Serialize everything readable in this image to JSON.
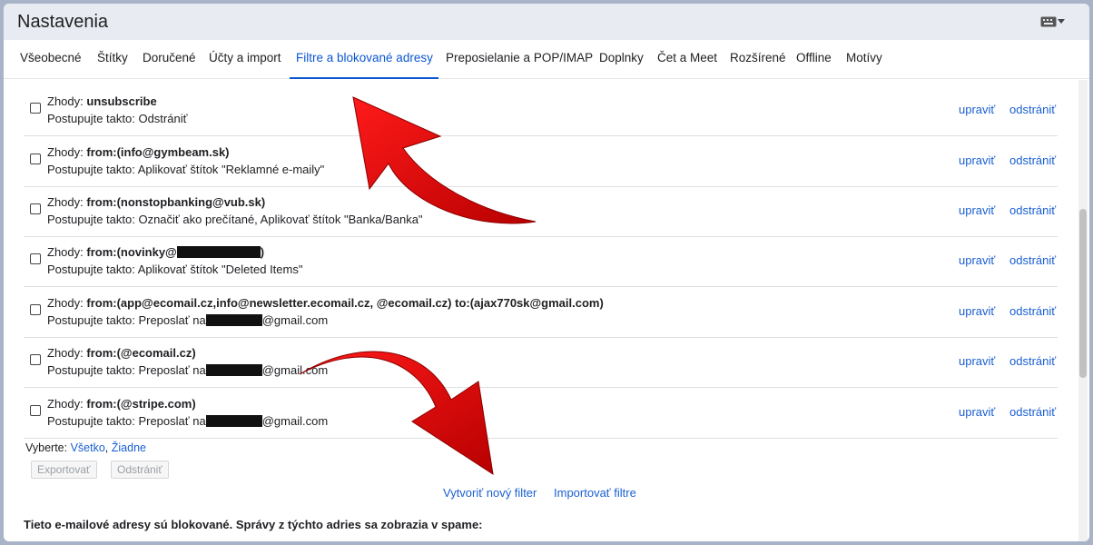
{
  "window": {
    "title": "Nastavenia",
    "input_icon": "keyboard-icon"
  },
  "tabs": [
    {
      "label": "Všeobecné"
    },
    {
      "label": "Štítky"
    },
    {
      "label": "Doručené"
    },
    {
      "label": "Účty a import"
    },
    {
      "label": "Filtre a blokované adresy",
      "active": true
    },
    {
      "label": "Preposielanie a POP/IMAP"
    },
    {
      "label": "Doplnky"
    },
    {
      "label": "Čet a Meet"
    },
    {
      "label": "Rozšírené"
    },
    {
      "label": "Offline"
    },
    {
      "label": "Motívy"
    }
  ],
  "filters": [
    {
      "match_prefix": "Zhody:",
      "match": "unsubscribe",
      "action": "Postupujte takto: Odstrániť",
      "edit": "upraviť",
      "delete": "odstrániť"
    },
    {
      "match_prefix": "Zhody:",
      "match": "from:(info@gymbeam.sk)",
      "action": "Postupujte takto: Aplikovať štítok \"Reklamné e-maily\"",
      "edit": "upraviť",
      "delete": "odstrániť"
    },
    {
      "match_prefix": "Zhody:",
      "match": "from:(nonstopbanking@vub.sk)",
      "action": "Postupujte takto: Označiť ako prečítané, Aplikovať štítok \"Banka/Banka\"",
      "edit": "upraviť",
      "delete": "odstrániť"
    },
    {
      "match_prefix": "Zhody:",
      "match": "from:(novinky@",
      "match_suffix": ")",
      "action": "Postupujte takto: Aplikovať štítok \"Deleted Items\"",
      "edit": "upraviť",
      "delete": "odstrániť"
    },
    {
      "match_prefix": "Zhody:",
      "match": "from:(app@ecomail.cz,info@newsletter.ecomail.cz, @ecomail.cz) to:(ajax770sk@gmail.com)",
      "action": "Postupujte takto: Preposlať na",
      "action_suffix": "@gmail.com",
      "edit": "upraviť",
      "delete": "odstrániť"
    },
    {
      "match_prefix": "Zhody:",
      "match": "from:(@ecomail.cz)",
      "action": "Postupujte takto: Preposlať na",
      "action_suffix": "@gmail.com",
      "edit": "upraviť",
      "delete": "odstrániť"
    },
    {
      "match_prefix": "Zhody:",
      "match": "from:(@stripe.com)",
      "action": "Postupujte takto: Preposlať na",
      "action_suffix": "@gmail.com",
      "edit": "upraviť",
      "delete": "odstrániť"
    }
  ],
  "selection": {
    "label": "Vyberte:",
    "all": "Všetko",
    "none": "Žiadne",
    "export": "Exportovať",
    "remove": "Odstrániť"
  },
  "links": {
    "new_filter": "Vytvoriť nový filter",
    "import_filters": "Importovať filtre"
  },
  "blocked": {
    "heading": "Tieto e-mailové adresy sú blokované. Správy z týchto adries sa zobrazia v spame:"
  },
  "colors": {
    "accent": "#0b57d0",
    "link": "#1a5fd1",
    "annotation_arrow": "#e00000"
  }
}
